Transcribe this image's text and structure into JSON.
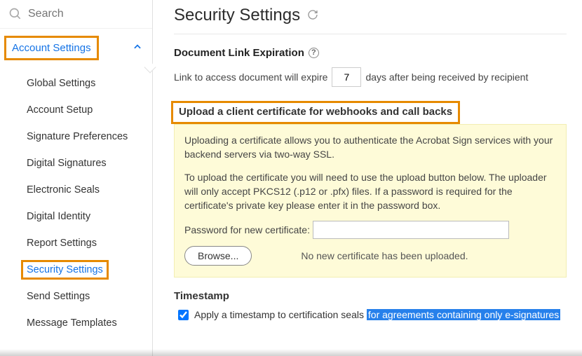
{
  "search": {
    "placeholder": "Search"
  },
  "sidebar": {
    "group_title": "Account Settings",
    "items": [
      {
        "label": "Global Settings"
      },
      {
        "label": "Account Setup"
      },
      {
        "label": "Signature Preferences"
      },
      {
        "label": "Digital Signatures"
      },
      {
        "label": "Electronic Seals"
      },
      {
        "label": "Digital Identity"
      },
      {
        "label": "Report Settings"
      },
      {
        "label": "Security Settings"
      },
      {
        "label": "Send Settings"
      },
      {
        "label": "Message Templates"
      }
    ]
  },
  "page": {
    "title": "Security Settings",
    "link_exp": {
      "heading": "Document Link Expiration",
      "pre": "Link to access document will expire",
      "value": "7",
      "post": "days after being received by recipient"
    },
    "upload": {
      "heading": "Upload a client certificate for webhooks and call backs",
      "p1": "Uploading a certificate allows you to authenticate the Acrobat Sign services with your backend servers via two-way SSL.",
      "p2": "To upload the certificate you will need to use the upload button below. The uploader will only accept PKCS12 (.p12 or .pfx) files. If a password is required for the certificate's private key please enter it in the password box.",
      "pw_label": "Password for new certificate:",
      "browse": "Browse...",
      "no_cert": "No new certificate has been uploaded."
    },
    "timestamp": {
      "heading": "Timestamp",
      "pre": "Apply a timestamp to certification seals ",
      "hl": "for agreements containing only e-signatures",
      "checked": true
    }
  }
}
